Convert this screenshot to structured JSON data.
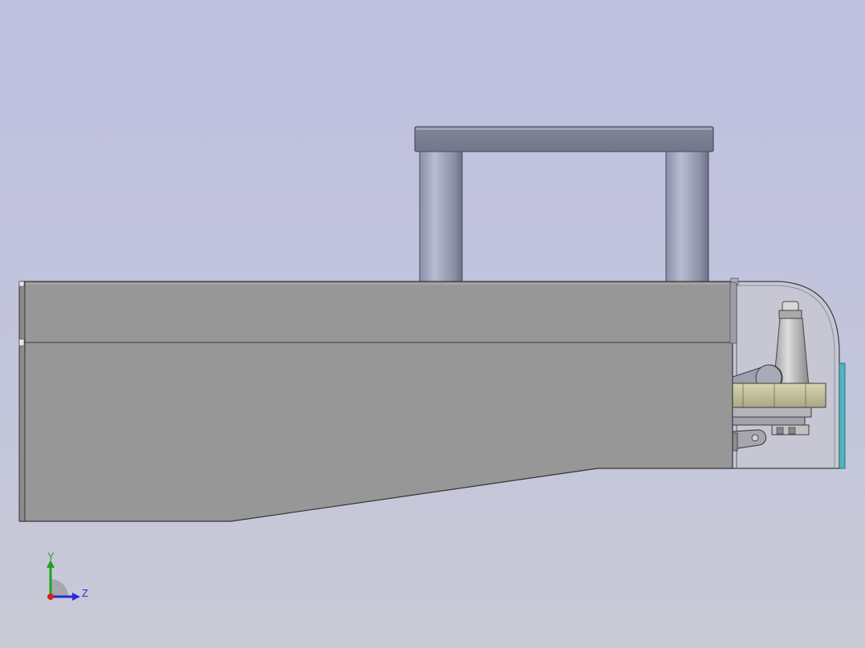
{
  "viewport": {
    "background_top": "#bfbfe0",
    "background_bottom": "#c8cad6"
  },
  "triad": {
    "y_label": "Y",
    "z_label": "Z",
    "y_color": "#1fa31f",
    "z_color": "#2a2ad8",
    "x_color": "#d81f1f"
  },
  "model": {
    "body_color": "#979797",
    "handle_color": "#868aa0",
    "guard_color": "#c5c6d2",
    "clamp_color": "#c9c7a0"
  }
}
